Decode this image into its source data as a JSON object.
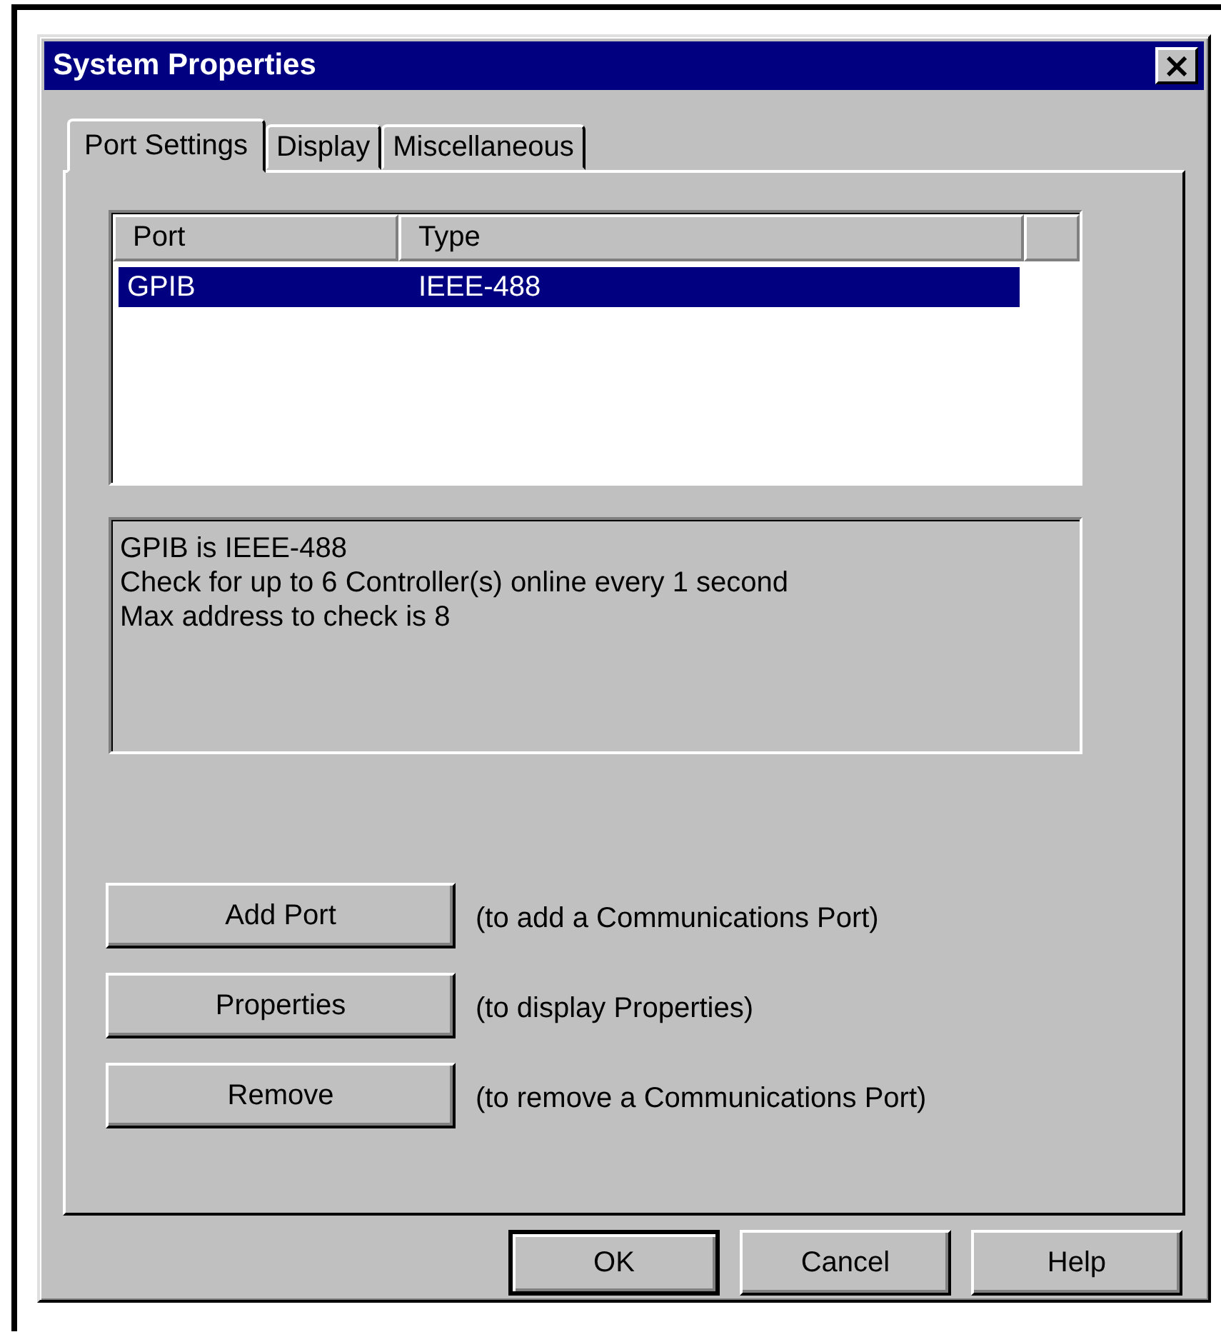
{
  "window": {
    "title": "System Properties",
    "close_label": "×"
  },
  "tabs": [
    {
      "label": "Port Settings",
      "selected": true
    },
    {
      "label": "Display",
      "selected": false
    },
    {
      "label": "Miscellaneous",
      "selected": false
    }
  ],
  "port_table": {
    "columns": [
      "Port",
      "Type"
    ],
    "rows": [
      {
        "cells": [
          "GPIB",
          "IEEE-488"
        ],
        "selected": true
      }
    ]
  },
  "description": {
    "lines": [
      "GPIB is IEEE-488",
      "Check for up to 6 Controller(s) online every 1 second",
      "Max address to check is 8"
    ]
  },
  "actions": [
    {
      "label": "Add Port",
      "hint": "(to add a Communications Port)"
    },
    {
      "label": "Properties",
      "hint": "(to display Properties)"
    },
    {
      "label": "Remove",
      "hint": "(to remove a Communications Port)"
    }
  ],
  "buttons": [
    {
      "label": "OK",
      "default": true
    },
    {
      "label": "Cancel",
      "default": false
    },
    {
      "label": "Help",
      "default": false
    }
  ]
}
